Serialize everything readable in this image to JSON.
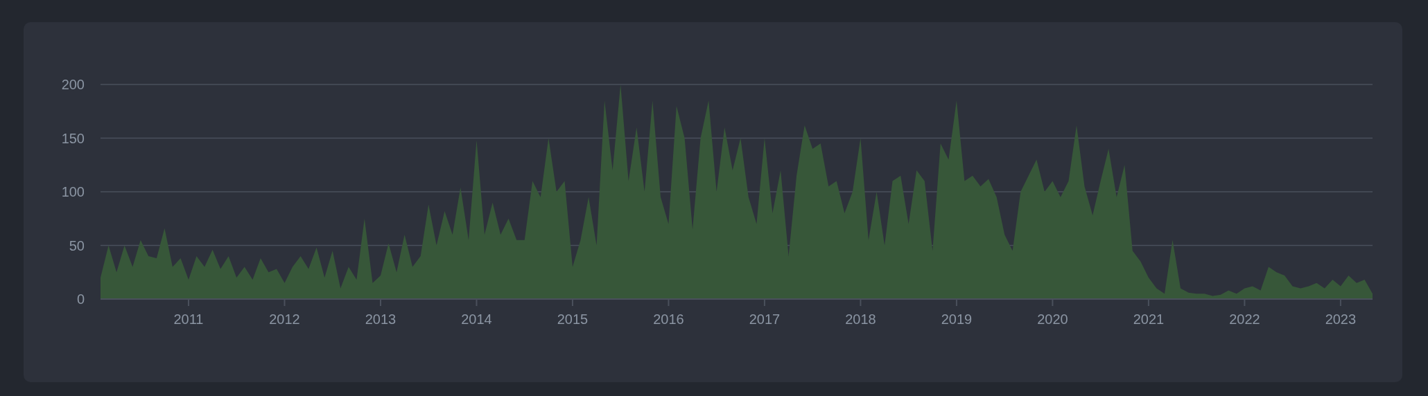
{
  "chart": {
    "chart_data": {
      "type": "area",
      "xlim": [
        2010.083,
        2023.333
      ],
      "ylim": [
        0,
        200
      ],
      "yticks": [
        0,
        50,
        100,
        150,
        200
      ],
      "xticks": [
        {
          "value": 2011,
          "label": "2011"
        },
        {
          "value": 2012,
          "label": "2012"
        },
        {
          "value": 2013,
          "label": "2013"
        },
        {
          "value": 2014,
          "label": "2014"
        },
        {
          "value": 2015,
          "label": "2015"
        },
        {
          "value": 2016,
          "label": "2016"
        },
        {
          "value": 2017,
          "label": "2017"
        },
        {
          "value": 2018,
          "label": "2018"
        },
        {
          "value": 2019,
          "label": "2019"
        },
        {
          "value": 2020,
          "label": "2020"
        },
        {
          "value": 2021,
          "label": "2021"
        },
        {
          "value": 2022,
          "label": "2022"
        },
        {
          "value": 2023,
          "label": "2023"
        }
      ],
      "grid": true,
      "x": [
        2010.083,
        2010.167,
        2010.25,
        2010.333,
        2010.417,
        2010.5,
        2010.583,
        2010.667,
        2010.75,
        2010.833,
        2010.917,
        2011,
        2011.083,
        2011.167,
        2011.25,
        2011.333,
        2011.417,
        2011.5,
        2011.583,
        2011.667,
        2011.75,
        2011.833,
        2011.917,
        2012,
        2012.083,
        2012.167,
        2012.25,
        2012.333,
        2012.417,
        2012.5,
        2012.583,
        2012.667,
        2012.75,
        2012.833,
        2012.917,
        2013,
        2013.083,
        2013.167,
        2013.25,
        2013.333,
        2013.417,
        2013.5,
        2013.583,
        2013.667,
        2013.75,
        2013.833,
        2013.917,
        2014,
        2014.083,
        2014.167,
        2014.25,
        2014.333,
        2014.417,
        2014.5,
        2014.583,
        2014.667,
        2014.75,
        2014.833,
        2014.917,
        2015,
        2015.083,
        2015.167,
        2015.25,
        2015.333,
        2015.417,
        2015.5,
        2015.583,
        2015.667,
        2015.75,
        2015.833,
        2015.917,
        2016,
        2016.083,
        2016.167,
        2016.25,
        2016.333,
        2016.417,
        2016.5,
        2016.583,
        2016.667,
        2016.75,
        2016.833,
        2016.917,
        2017,
        2017.083,
        2017.167,
        2017.25,
        2017.333,
        2017.417,
        2017.5,
        2017.583,
        2017.667,
        2017.75,
        2017.833,
        2017.917,
        2018,
        2018.083,
        2018.167,
        2018.25,
        2018.333,
        2018.417,
        2018.5,
        2018.583,
        2018.667,
        2018.75,
        2018.833,
        2018.917,
        2019,
        2019.083,
        2019.167,
        2019.25,
        2019.333,
        2019.417,
        2019.5,
        2019.583,
        2019.667,
        2019.75,
        2019.833,
        2019.917,
        2020,
        2020.083,
        2020.167,
        2020.25,
        2020.333,
        2020.417,
        2020.5,
        2020.583,
        2020.667,
        2020.75,
        2020.833,
        2020.917,
        2021,
        2021.083,
        2021.167,
        2021.25,
        2021.333,
        2021.417,
        2021.5,
        2021.583,
        2021.667,
        2021.75,
        2021.833,
        2021.917,
        2022,
        2022.083,
        2022.167,
        2022.25,
        2022.333,
        2022.417,
        2022.5,
        2022.583,
        2022.667,
        2022.75,
        2022.833,
        2022.917,
        2023,
        2023.083,
        2023.167,
        2023.25,
        2023.333
      ],
      "series": [
        {
          "color": "#375739",
          "values": [
            20,
            50,
            25,
            50,
            30,
            55,
            40,
            38,
            66,
            30,
            38,
            18,
            40,
            30,
            46,
            28,
            40,
            20,
            30,
            18,
            38,
            25,
            28,
            15,
            30,
            40,
            28,
            48,
            20,
            45,
            10,
            30,
            18,
            75,
            15,
            22,
            52,
            25,
            60,
            30,
            40,
            88,
            50,
            82,
            60,
            104,
            55,
            148,
            60,
            90,
            60,
            75,
            55,
            55,
            110,
            95,
            150,
            100,
            110,
            30,
            55,
            95,
            50,
            185,
            120,
            200,
            110,
            160,
            100,
            185,
            95,
            70,
            180,
            150,
            65,
            150,
            185,
            100,
            160,
            120,
            150,
            95,
            70,
            150,
            80,
            120,
            40,
            115,
            162,
            140,
            145,
            105,
            110,
            80,
            100,
            150,
            55,
            100,
            50,
            110,
            115,
            70,
            120,
            110,
            45,
            145,
            130,
            185,
            110,
            115,
            105,
            112,
            95,
            60,
            45,
            100,
            115,
            130,
            100,
            110,
            95,
            110,
            162,
            105,
            78,
            110,
            140,
            95,
            125,
            45,
            35,
            20,
            10,
            5,
            55,
            10,
            6,
            5,
            5,
            3,
            4,
            8,
            5,
            10,
            12,
            8,
            30,
            25,
            22,
            12,
            10,
            12,
            15,
            10,
            18,
            12,
            22,
            15,
            18,
            5
          ]
        }
      ]
    }
  }
}
